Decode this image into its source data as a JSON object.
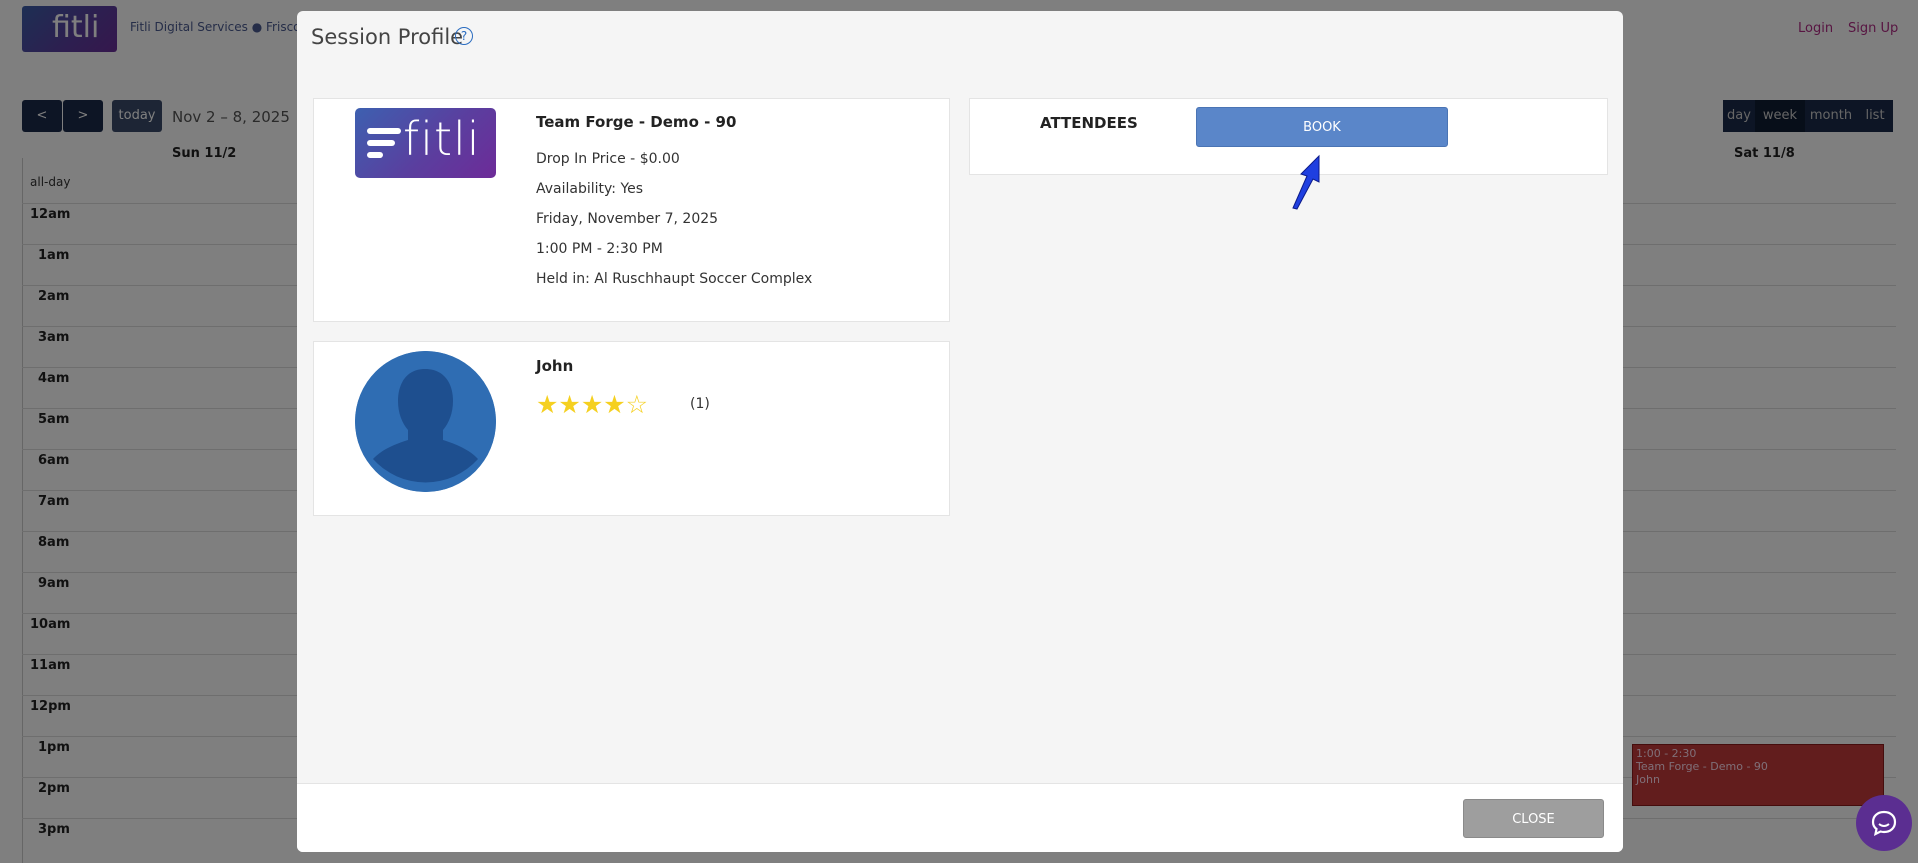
{
  "background": {
    "brand": "Fitli Digital Services",
    "location": "Frisco",
    "login_label": "Login",
    "signup_label": "Sign Up",
    "nav": {
      "prev": "<",
      "next": ">",
      "today": "today",
      "range": "Nov 2 – 8, 2025"
    },
    "views": [
      "day",
      "week",
      "month",
      "list"
    ],
    "days": {
      "sun": "Sun 11/2",
      "sat": "Sat 11/8"
    },
    "allday_label": "all-day",
    "hours": [
      "12am",
      "1am",
      "2am",
      "3am",
      "4am",
      "5am",
      "6am",
      "7am",
      "8am",
      "9am",
      "10am",
      "11am",
      "12pm",
      "1pm",
      "2pm",
      "3pm"
    ],
    "event": {
      "time": "1:00 - 2:30",
      "title": "Team Forge - Demo - 90",
      "trainer": "John"
    }
  },
  "modal": {
    "title": "Session Profile",
    "help_glyph": "?",
    "session": {
      "logo_text": "fitli",
      "name": "Team Forge - Demo - 90",
      "price": "Drop In Price - $0.00",
      "availability": "Availability: Yes",
      "date": "Friday, November 7, 2025",
      "time": "1:00 PM - 2:30 PM",
      "location": "Held in: Al Ruschhaupt Soccer Complex"
    },
    "trainer": {
      "name": "John",
      "rating": 4,
      "rating_max": 5,
      "stars_filled": "★★★★",
      "stars_empty": "☆",
      "rating_count": "(1)"
    },
    "attendees": {
      "label": "ATTENDEES",
      "book_label": "BOOK"
    },
    "close_label": "CLOSE"
  },
  "colors": {
    "book_button": "#5a86c9",
    "close_button": "#9e9e9e",
    "star": "#f5d020",
    "chat": "#5b2e91",
    "arrow": "#1f3fe0"
  }
}
